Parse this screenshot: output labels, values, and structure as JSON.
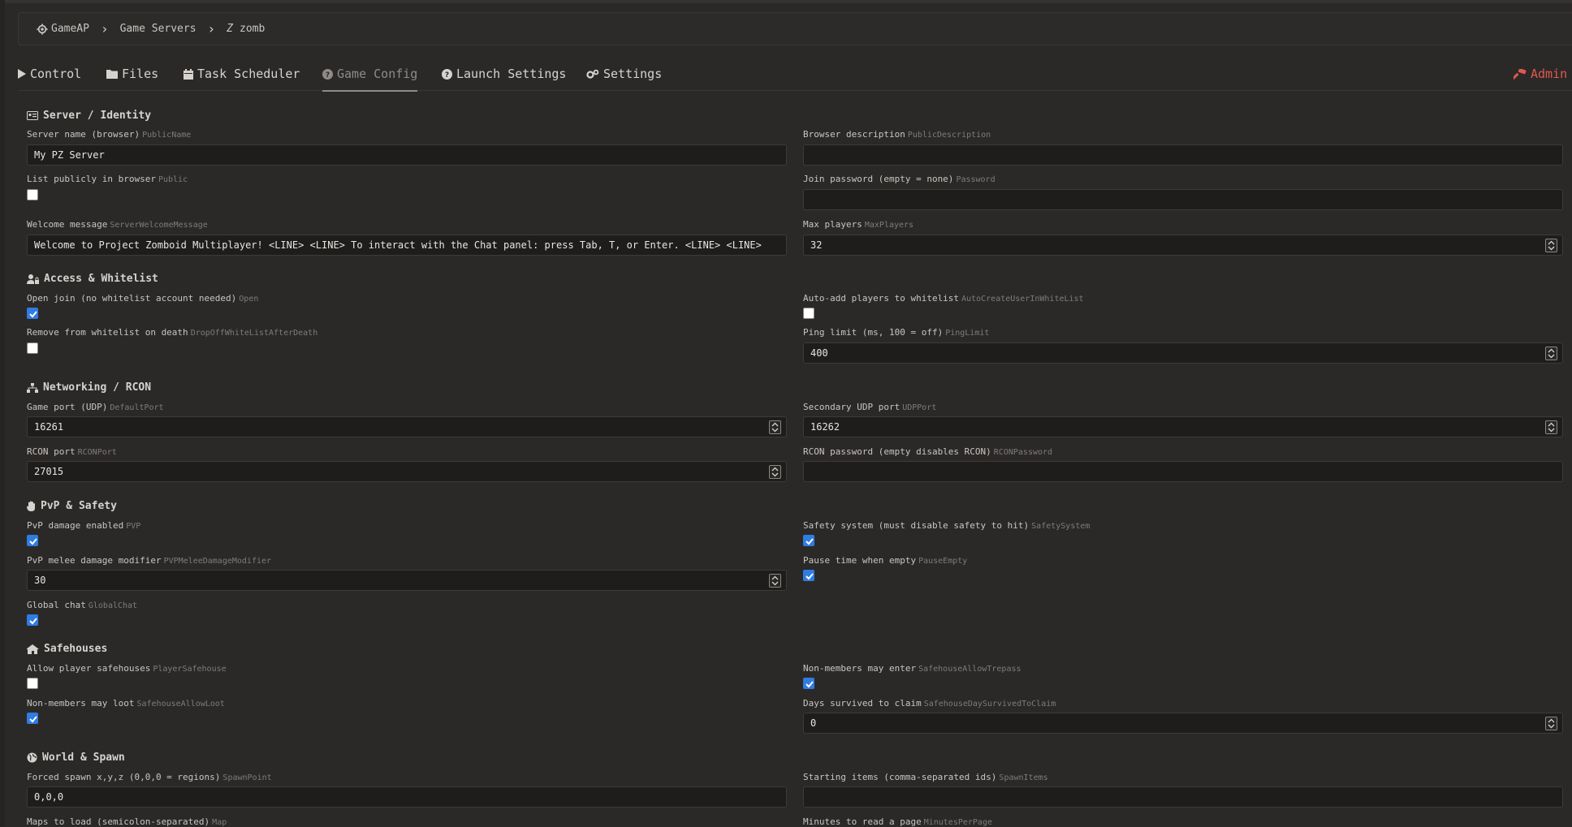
{
  "breadcrumb": {
    "root": "GameAP",
    "servers": "Game Servers",
    "current": "zomb"
  },
  "tabs": {
    "control": "Control",
    "files": "Files",
    "task_scheduler": "Task Scheduler",
    "game_config": "Game Config",
    "launch_settings": "Launch Settings",
    "settings": "Settings",
    "admin": "Admin"
  },
  "colors": {
    "accent": "#2f7ce3",
    "admin": "#e05a4e",
    "bg": "#2b2928"
  },
  "sections": {
    "identity": {
      "title": "Server / Identity",
      "public_name": {
        "label": "Server name (browser)",
        "key": "PublicName",
        "value": "My PZ Server"
      },
      "public_description": {
        "label": "Browser description",
        "key": "PublicDescription",
        "value": ""
      },
      "public": {
        "label": "List publicly in browser",
        "key": "Public",
        "checked": false
      },
      "password": {
        "label": "Join password (empty = none)",
        "key": "Password",
        "value": ""
      },
      "welcome": {
        "label": "Welcome message",
        "key": "ServerWelcomeMessage",
        "value": "Welcome to Project Zomboid Multiplayer! <LINE> <LINE> To interact with the Chat panel: press Tab, T, or Enter. <LINE> <LINE>"
      },
      "max_players": {
        "label": "Max players",
        "key": "MaxPlayers",
        "value": "32"
      }
    },
    "access": {
      "title": "Access & Whitelist",
      "open": {
        "label": "Open join (no whitelist account needed)",
        "key": "Open",
        "checked": true
      },
      "auto_create": {
        "label": "Auto-add players to whitelist",
        "key": "AutoCreateUserInWhiteList",
        "checked": false
      },
      "drop_off": {
        "label": "Remove from whitelist on death",
        "key": "DropOffWhiteListAfterDeath",
        "checked": false
      },
      "ping_limit": {
        "label": "Ping limit (ms, 100 = off)",
        "key": "PingLimit",
        "value": "400"
      }
    },
    "network": {
      "title": "Networking / RCON",
      "default_port": {
        "label": "Game port (UDP)",
        "key": "DefaultPort",
        "value": "16261"
      },
      "udp_port": {
        "label": "Secondary UDP port",
        "key": "UDPPort",
        "value": "16262"
      },
      "rcon_port": {
        "label": "RCON port",
        "key": "RCONPort",
        "value": "27015"
      },
      "rcon_password": {
        "label": "RCON password (empty disables RCON)",
        "key": "RCONPassword",
        "value": ""
      }
    },
    "pvp": {
      "title": "PvP & Safety",
      "pvp": {
        "label": "PvP damage enabled",
        "key": "PVP",
        "checked": true
      },
      "safety": {
        "label": "Safety system (must disable safety to hit)",
        "key": "SafetySystem",
        "checked": true
      },
      "melee": {
        "label": "PvP melee damage modifier",
        "key": "PVPMeleeDamageModifier",
        "value": "30"
      },
      "pause_empty": {
        "label": "Pause time when empty",
        "key": "PauseEmpty",
        "checked": true
      },
      "global_chat": {
        "label": "Global chat",
        "key": "GlobalChat",
        "checked": true
      }
    },
    "safehouse": {
      "title": "Safehouses",
      "player_safehouse": {
        "label": "Allow player safehouses",
        "key": "PlayerSafehouse",
        "checked": false
      },
      "trespass": {
        "label": "Non-members may enter",
        "key": "SafehouseAllowTrepass",
        "checked": true
      },
      "loot": {
        "label": "Non-members may loot",
        "key": "SafehouseAllowLoot",
        "checked": true
      },
      "days": {
        "label": "Days survived to claim",
        "key": "SafehouseDaySurvivedToClaim",
        "value": "0"
      }
    },
    "world": {
      "title": "World & Spawn",
      "spawn_point": {
        "label": "Forced spawn x,y,z (0,0,0 = regions)",
        "key": "SpawnPoint",
        "value": "0,0,0"
      },
      "spawn_items": {
        "label": "Starting items (comma-separated ids)",
        "key": "SpawnItems",
        "value": ""
      },
      "map": {
        "label": "Maps to load (semicolon-separated)",
        "key": "Map"
      },
      "minutes_per_page": {
        "label": "Minutes to read a page",
        "key": "MinutesPerPage"
      }
    }
  }
}
